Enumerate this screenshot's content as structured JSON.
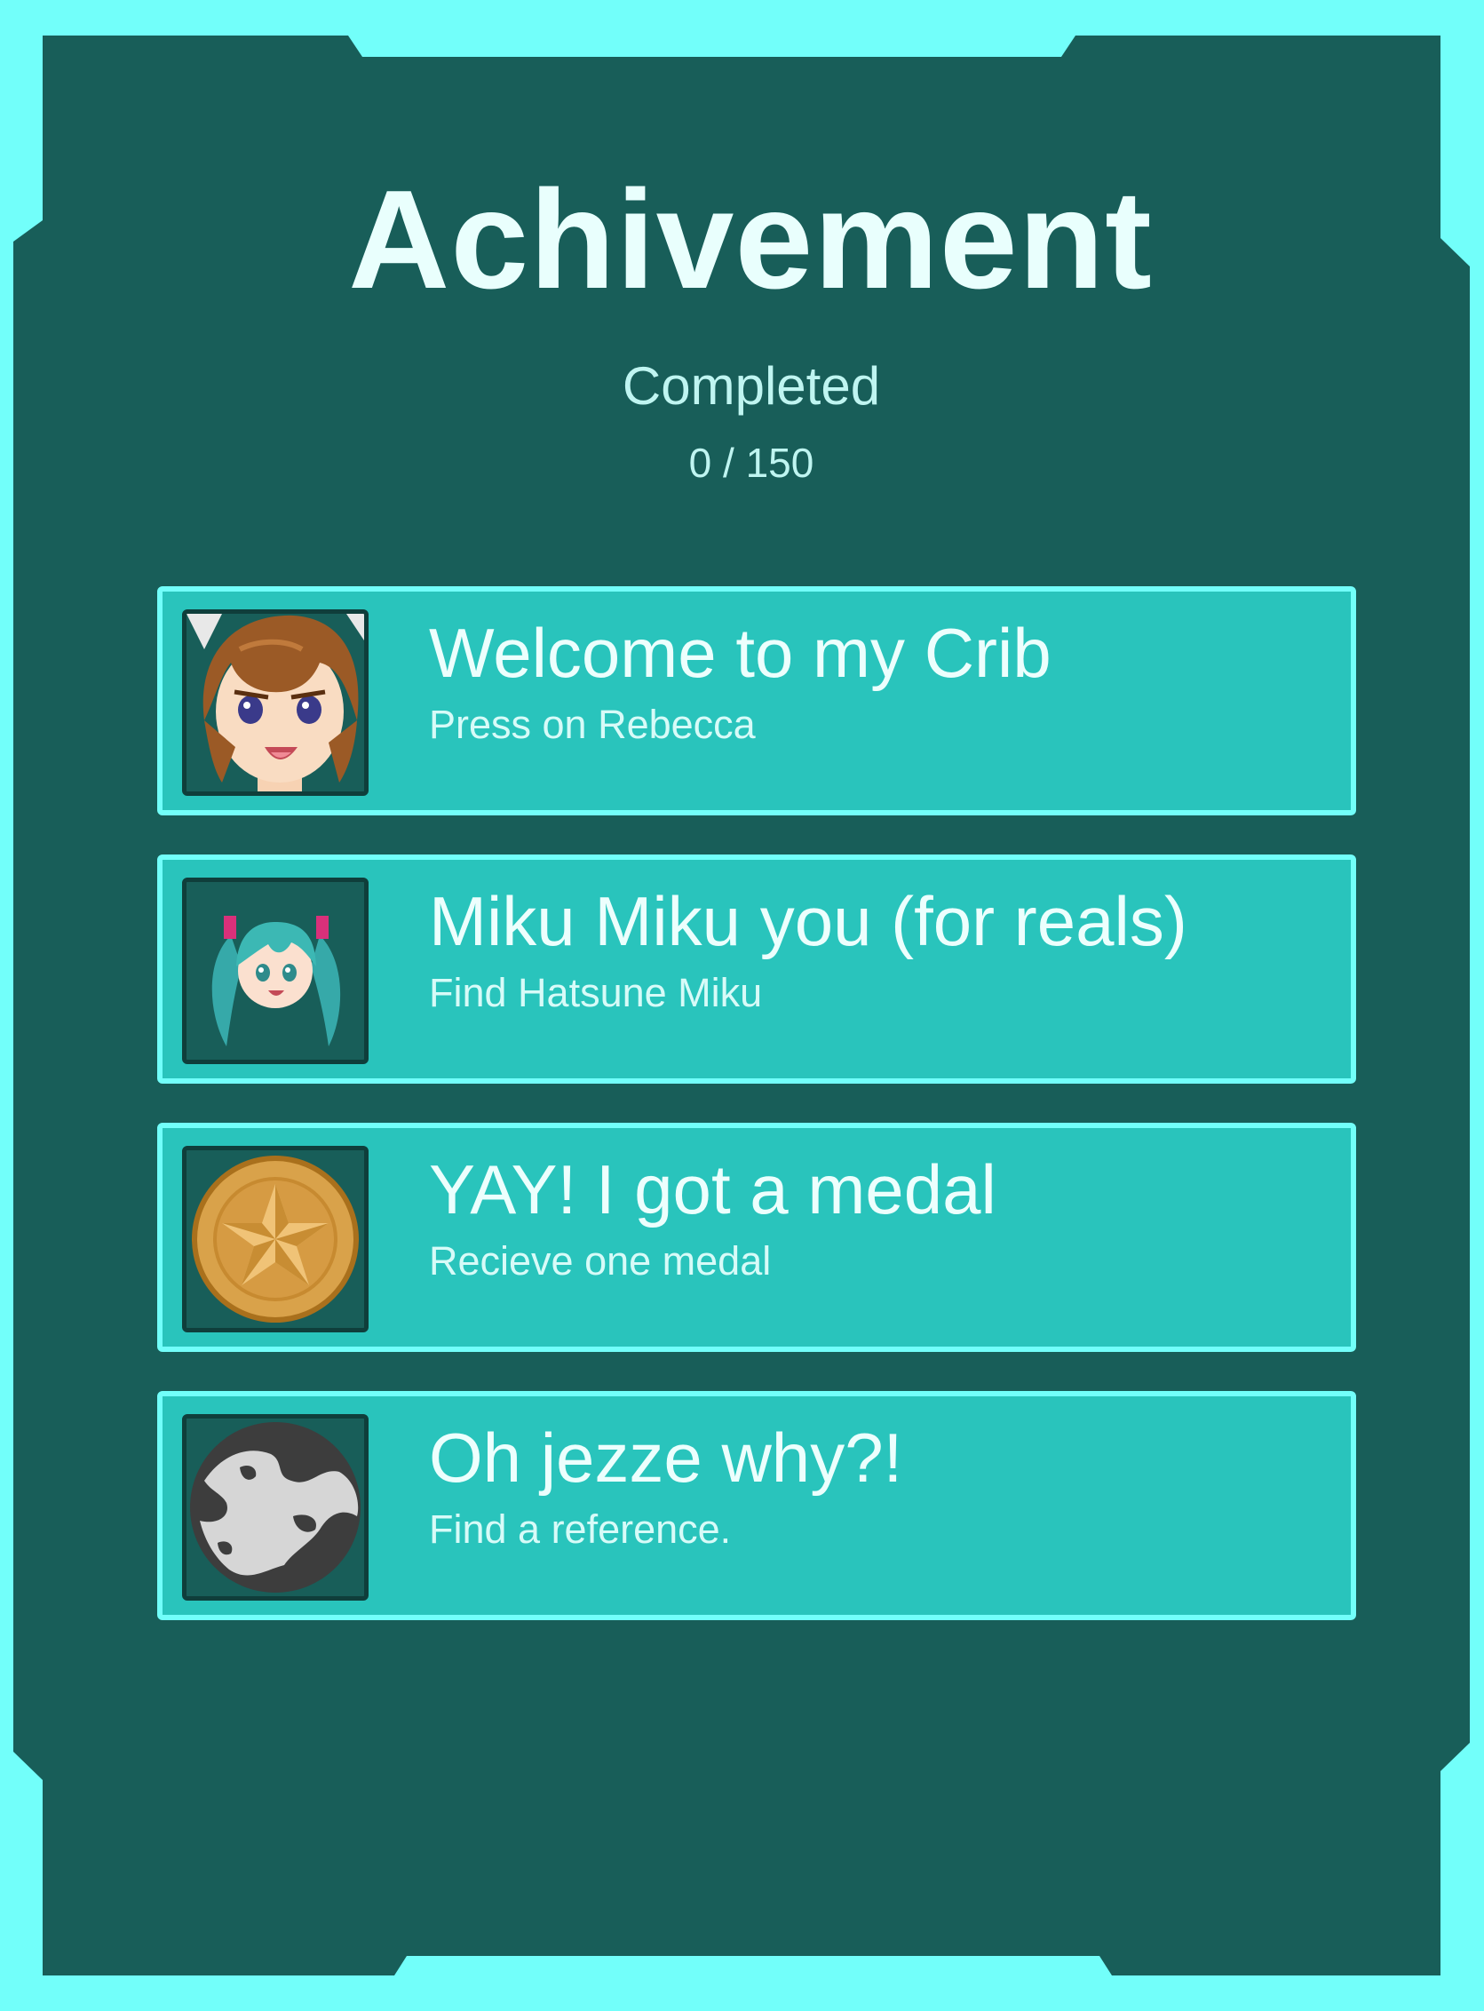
{
  "colors": {
    "outer_frame": "#72fffa",
    "panel": "#185e59",
    "card": "#29c4bc",
    "card_border": "#72fffa",
    "title_text": "#e9fffd",
    "secondary_text": "#bff5f1"
  },
  "header": {
    "title": "Achivement",
    "progress_label": "Completed",
    "progress_count": "0 / 150"
  },
  "progress": {
    "completed": 0,
    "total": 150
  },
  "achievements": [
    {
      "title": "Welcome to my Crib",
      "description": "Press on Rebecca",
      "icon": "rebecca-portrait-icon"
    },
    {
      "title": "Miku Miku you (for reals)",
      "description": "Find Hatsune Miku",
      "icon": "hatsune-miku-icon"
    },
    {
      "title": "YAY! I got a medal",
      "description": "Recieve one medal",
      "icon": "gold-star-medal-icon"
    },
    {
      "title": "Oh jezze why?!",
      "description": "Find a reference.",
      "icon": "moon-globe-icon"
    }
  ]
}
